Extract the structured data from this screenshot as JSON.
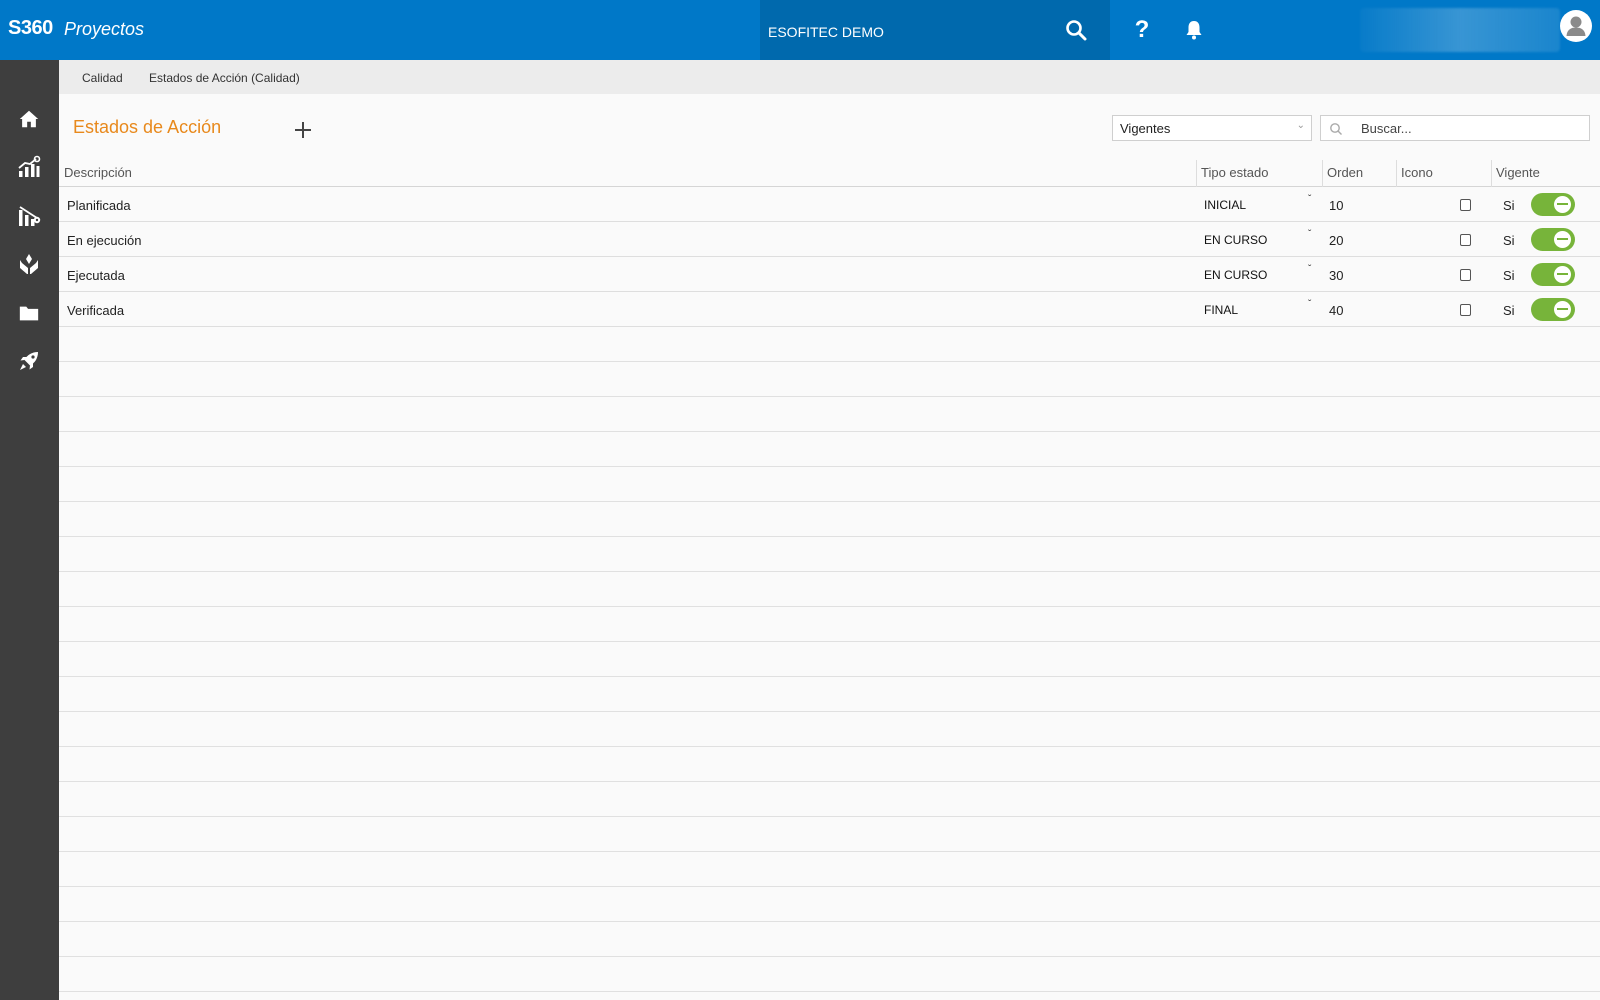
{
  "topbar": {
    "brand": "S360",
    "app_name": "Proyectos",
    "company": "ESOFITEC DEMO",
    "help_label": "?"
  },
  "breadcrumb": [
    "Calidad",
    "Estados de Acción (Calidad)"
  ],
  "page": {
    "title": "Estados de Acción",
    "filter_value": "Vigentes",
    "search_placeholder": "Buscar..."
  },
  "table": {
    "headers": {
      "descripcion": "Descripción",
      "tipo": "Tipo estado",
      "orden": "Orden",
      "icono": "Icono",
      "vigente": "Vigente"
    },
    "rows": [
      {
        "descripcion": "Planificada",
        "tipo": "INICIAL",
        "orden": "10",
        "vigente": "Si"
      },
      {
        "descripcion": "En ejecución",
        "tipo": "EN CURSO",
        "orden": "20",
        "vigente": "Si"
      },
      {
        "descripcion": "Ejecutada",
        "tipo": "EN CURSO",
        "orden": "30",
        "vigente": "Si"
      },
      {
        "descripcion": "Verificada",
        "tipo": "FINAL",
        "orden": "40",
        "vigente": "Si"
      }
    ]
  },
  "sidebar": {
    "icons": [
      "home-icon",
      "chart-growth-icon",
      "chart-bars-icon",
      "hands-care-icon",
      "folder-icon",
      "rocket-icon"
    ]
  },
  "colors": {
    "topbar": "#0078c8",
    "company_bg": "#0069ad",
    "sidebar": "#3e3e3e",
    "title_accent": "#e8891c",
    "toggle_on": "#77b43a"
  }
}
